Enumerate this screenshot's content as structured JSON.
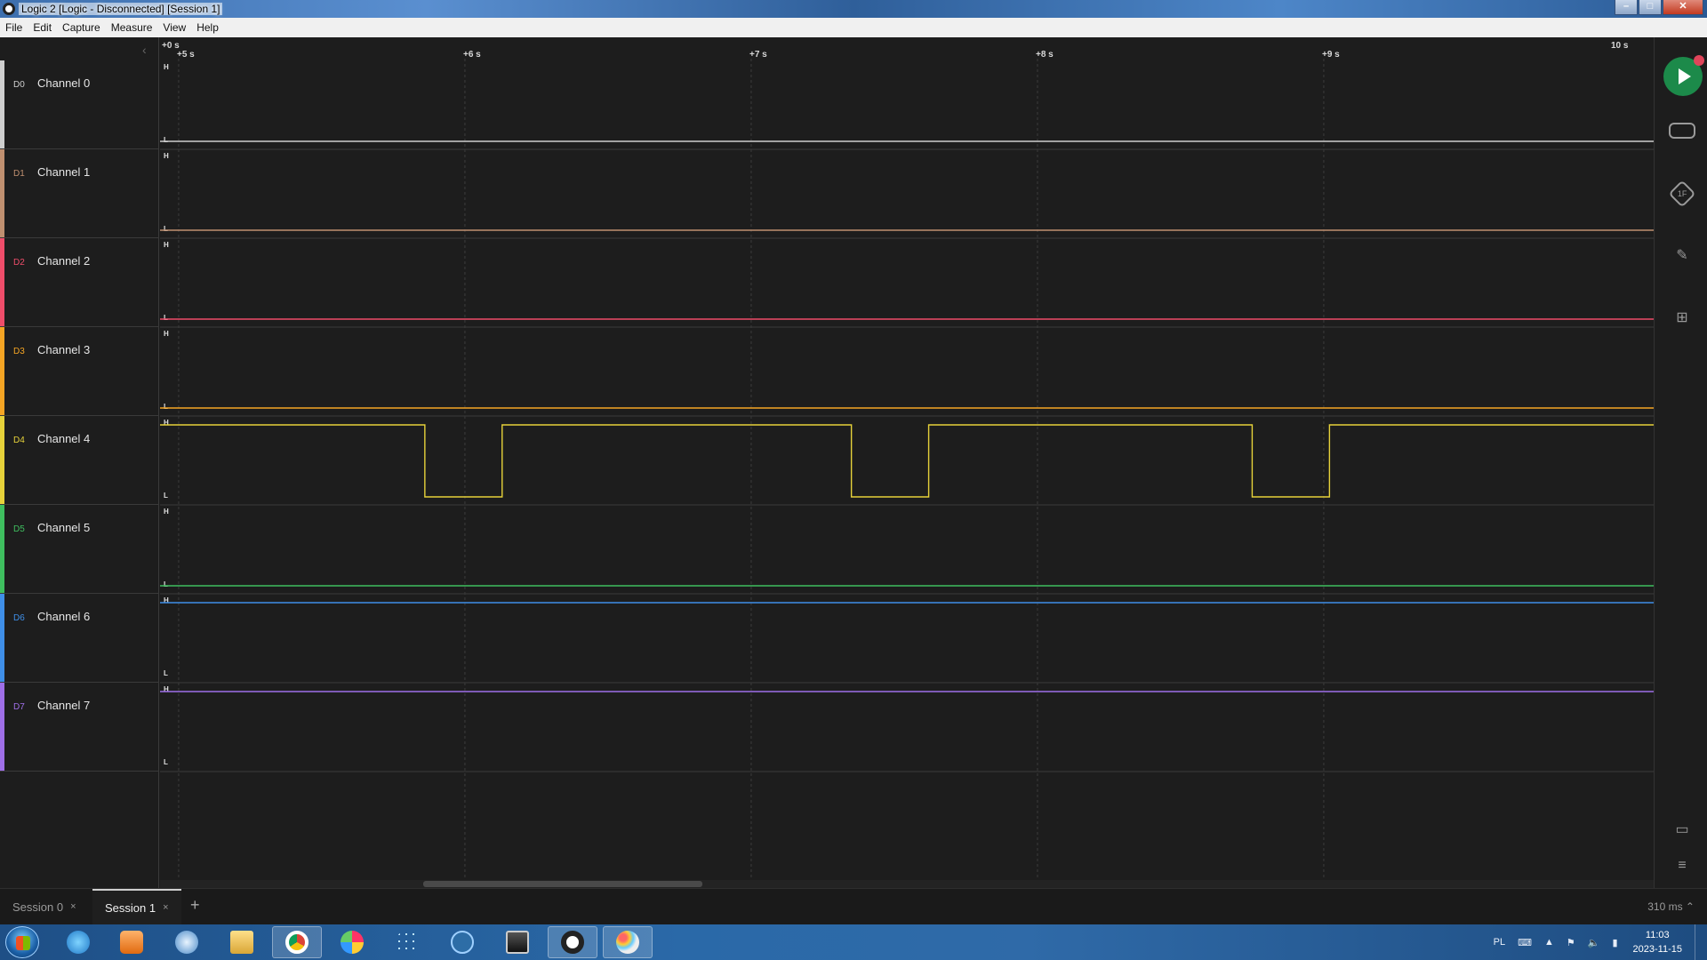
{
  "window": {
    "title": "Logic 2 [Logic - Disconnected] [Session 1]",
    "min_icon": "minimize-icon",
    "max_icon": "maximize-icon",
    "close_icon": "close-icon"
  },
  "menu": [
    "File",
    "Edit",
    "Capture",
    "Measure",
    "View",
    "Help"
  ],
  "timeline": {
    "top_left": "+0 s",
    "top_right": "10 s",
    "ticks": [
      "+5 s",
      "+6 s",
      "+7 s",
      "+8 s",
      "+9 s"
    ],
    "high_label": "H",
    "low_label": "L"
  },
  "channels": [
    {
      "id": "D0",
      "name": "Channel 0",
      "color": "#cfcfcf",
      "level": "low"
    },
    {
      "id": "D1",
      "name": "Channel 1",
      "color": "#c09070",
      "level": "low"
    },
    {
      "id": "D2",
      "name": "Channel 2",
      "color": "#ef4d6a",
      "level": "low"
    },
    {
      "id": "D3",
      "name": "Channel 3",
      "color": "#f5a524",
      "level": "low"
    },
    {
      "id": "D4",
      "name": "Channel 4",
      "color": "#e6d23a",
      "level": "pulses",
      "low_intervals_s": [
        [
          5.86,
          6.13
        ],
        [
          7.35,
          7.62
        ],
        [
          8.75,
          9.02
        ]
      ]
    },
    {
      "id": "D5",
      "name": "Channel 5",
      "color": "#3fbf5f",
      "level": "low"
    },
    {
      "id": "D6",
      "name": "Channel 6",
      "color": "#3f8fe8",
      "level": "high"
    },
    {
      "id": "D7",
      "name": "Channel 7",
      "color": "#9f6fe8",
      "level": "high"
    }
  ],
  "right_toolbar": {
    "run_icon": "play-icon",
    "device_icon": "device-settings-icon",
    "trigger_icon": "trigger-icon",
    "trigger_text": "1F",
    "measure_icon": "ruler-icon",
    "extensions_icon": "extensions-icon",
    "comment_icon": "comment-icon",
    "menu_icon": "hamburger-menu-icon"
  },
  "sessions": [
    {
      "label": "Session 0",
      "active": false
    },
    {
      "label": "Session 1",
      "active": true
    }
  ],
  "session_close": "×",
  "add_session": "+",
  "capture_duration": "310 ms ⌃",
  "taskbar": {
    "apps": [
      "internet-explorer-icon",
      "media-player-icon",
      "ie-alt-icon",
      "file-explorer-icon",
      "chrome-icon",
      "puzzle-app-icon",
      "dots-app-icon",
      "mu-editor-icon",
      "video-editor-icon",
      "logic2-icon",
      "paint-icon"
    ],
    "language": "PL",
    "time": "11:03",
    "date": "2023-11-15"
  }
}
